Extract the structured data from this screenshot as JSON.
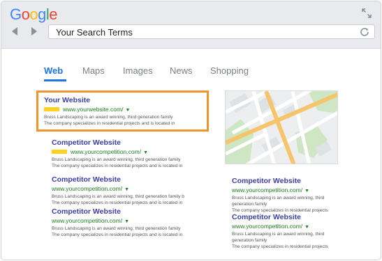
{
  "browser": {
    "logo_letters": [
      {
        "char": "G",
        "color": "#4285f4"
      },
      {
        "char": "o",
        "color": "#ea4335"
      },
      {
        "char": "o",
        "color": "#fbbc05"
      },
      {
        "char": "g",
        "color": "#4285f4"
      },
      {
        "char": "l",
        "color": "#34a853"
      },
      {
        "char": "e",
        "color": "#ea4335"
      }
    ],
    "search_value": "Your Search Terms"
  },
  "tabs": [
    {
      "label": "Web",
      "active": true
    },
    {
      "label": "Maps",
      "active": false
    },
    {
      "label": "Images",
      "active": false
    },
    {
      "label": "News",
      "active": false
    },
    {
      "label": "Shopping",
      "active": false
    }
  ],
  "featured": {
    "title": "Your Website",
    "url": "www.yourwebsite.com/",
    "desc1": "Bruss Landscaping is an award winning, third generation family",
    "desc2": "The company specializes in residential projects and is located in"
  },
  "left_results": [
    {
      "title": "Competitor Website",
      "url": "www.yourcompetition.com/",
      "ad": true,
      "desc1": "Bruss Landscaping is an award winning, third generation family",
      "desc2": "The company specializes in residential projects and is located in"
    },
    {
      "title": "Competitor Website",
      "url": "www.yourcompetition.com/",
      "ad": false,
      "desc1": "Bruss Landscaping is an award winning, third generation family b",
      "desc2": "The company specializes in residential projects and is located in"
    },
    {
      "title": "Competitor Website",
      "url": "www.yourcompetition.com/",
      "ad": false,
      "desc1": "Bruss Landscaping is an award winning, third generation family",
      "desc2": "The company specializes in residential projects and is located in"
    }
  ],
  "right_results": [
    {
      "title": "Competitor Website",
      "url": "www.yourcompetition.com/",
      "desc1": "Bruss Landscaping is an award winning, third",
      "desc2": "generation family",
      "desc3": "The company specializes in residential projects"
    },
    {
      "title": "Competitor Website",
      "url": "www.yourcompetition.com/",
      "desc1": "Bruss Landscaping is an award winning, third",
      "desc2": "generation family",
      "desc3": "The company specializes in residential projects"
    }
  ],
  "colors": {
    "accent_blue": "#1a73e8",
    "highlight_orange": "#f0932b",
    "ad_yellow": "#ffd21f",
    "url_green": "#1e7d22",
    "title_purple": "#3b3fa6"
  },
  "icons": {
    "expand": "expand-icon",
    "back": "back-arrow-icon",
    "forward": "forward-arrow-icon",
    "refresh": "refresh-icon",
    "url_caret": "dropdown-caret-icon"
  }
}
